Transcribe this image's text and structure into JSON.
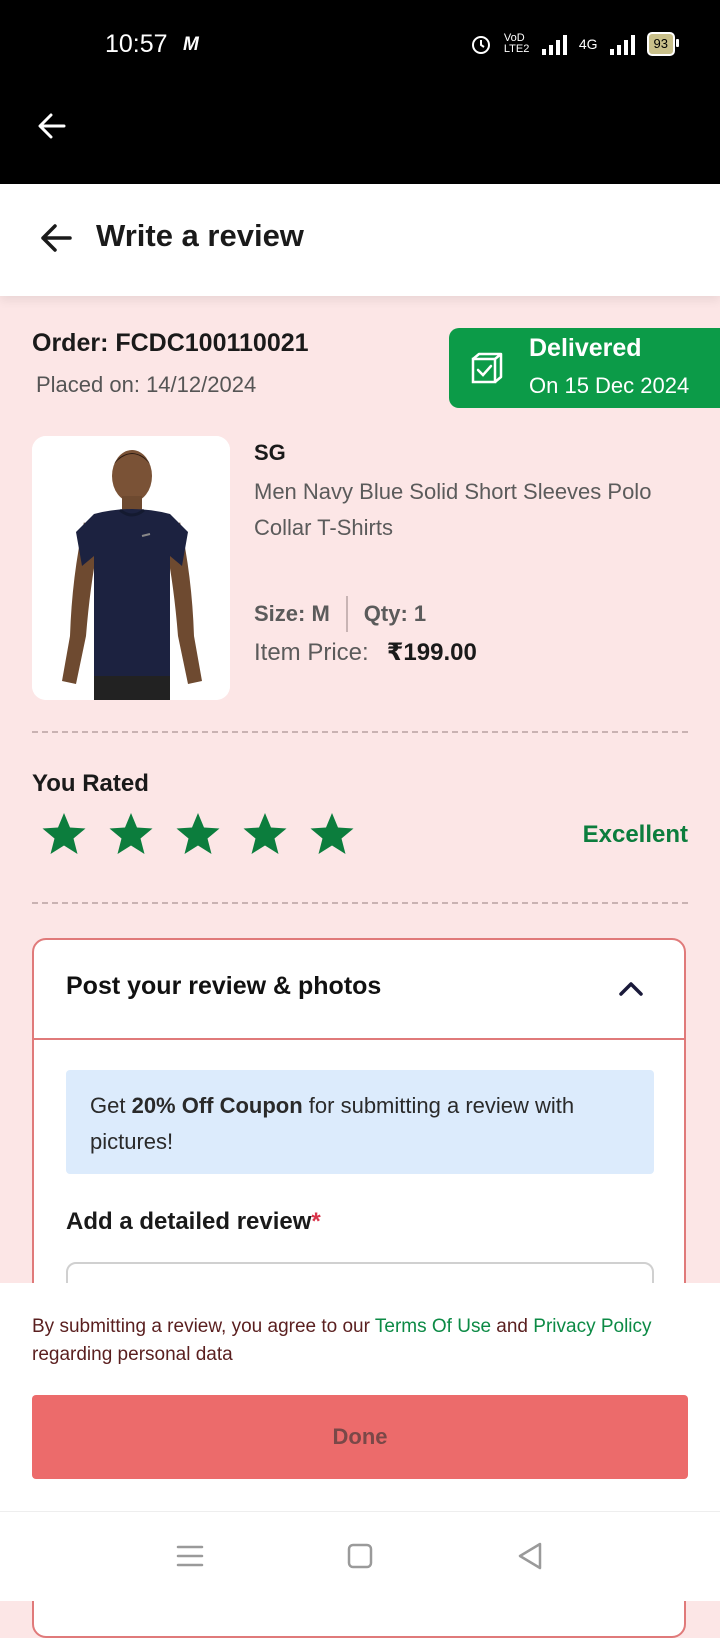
{
  "status_bar": {
    "time": "10:57",
    "carrier_badge": "M",
    "volte_label": "VoD LTE2",
    "network_label": "4G",
    "battery": "93"
  },
  "header": {
    "title": "Write a review"
  },
  "order": {
    "number": "Order: FCDC100110021",
    "placed_on": "Placed on: 14/12/2024",
    "status_title": "Delivered",
    "status_date": "On 15 Dec 2024"
  },
  "product": {
    "brand": "SG",
    "name": "Men Navy Blue Solid Short Sleeves Polo Collar T-Shirts",
    "size": "Size: M",
    "qty": "Qty: 1",
    "price_label": "Item Price:",
    "price_value": "₹199.00"
  },
  "rating": {
    "label": "You Rated",
    "stars": 5,
    "max_stars": 5,
    "text": "Excellent",
    "star_color": "#0c7d3d"
  },
  "review_section": {
    "title": "Post your review & photos",
    "coupon_prefix": "Get ",
    "coupon_bold": "20% Off Coupon",
    "coupon_suffix": " for submitting a review with pictures!",
    "detail_label": "Add a detailed review",
    "required_mark": "*"
  },
  "footer": {
    "terms_prefix": "By submitting a review, you agree to our ",
    "terms_link": "Terms Of Use",
    "terms_and": " and ",
    "privacy_link": "Privacy Policy",
    "terms_suffix": " regarding personal data",
    "done_label": "Done"
  },
  "colors": {
    "page_bg": "#fce6e6",
    "delivered_green": "#0c9b48",
    "done_button": "#ec6b6b",
    "coupon_bg": "#dcebfc"
  },
  "nav_icons": [
    "menu-icon",
    "home-square-icon",
    "back-triangle-icon"
  ]
}
